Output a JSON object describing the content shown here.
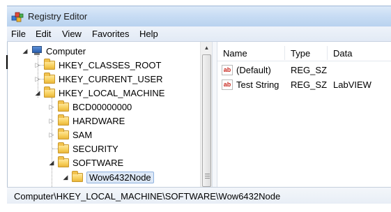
{
  "window": {
    "title": "Registry Editor",
    "accent": "#c9ddf4"
  },
  "menu": {
    "items": [
      "File",
      "Edit",
      "View",
      "Favorites",
      "Help"
    ]
  },
  "tree": {
    "root": "Computer",
    "items": [
      {
        "label": "HKEY_CLASSES_ROOT",
        "state": "collapsed"
      },
      {
        "label": "HKEY_CURRENT_USER",
        "state": "collapsed"
      },
      {
        "label": "HKEY_LOCAL_MACHINE",
        "state": "expanded"
      },
      {
        "label": "BCD00000000",
        "state": "collapsed"
      },
      {
        "label": "HARDWARE",
        "state": "collapsed"
      },
      {
        "label": "SAM",
        "state": "collapsed"
      },
      {
        "label": "SECURITY",
        "state": "leaf"
      },
      {
        "label": "SOFTWARE",
        "state": "expanded"
      },
      {
        "label": "Wow6432Node",
        "state": "expanded",
        "selected": true
      }
    ]
  },
  "list": {
    "columns": [
      "Name",
      "Type",
      "Data"
    ],
    "rows": [
      {
        "name": "(Default)",
        "type": "REG_SZ",
        "data": "",
        "icon": "string-value-icon"
      },
      {
        "name": "Test String",
        "type": "REG_SZ",
        "data": "LabVIEW",
        "icon": "string-value-icon"
      }
    ],
    "icon_glyph": "ab"
  },
  "status": {
    "path": "Computer\\HKEY_LOCAL_MACHINE\\SOFTWARE\\Wow6432Node"
  }
}
